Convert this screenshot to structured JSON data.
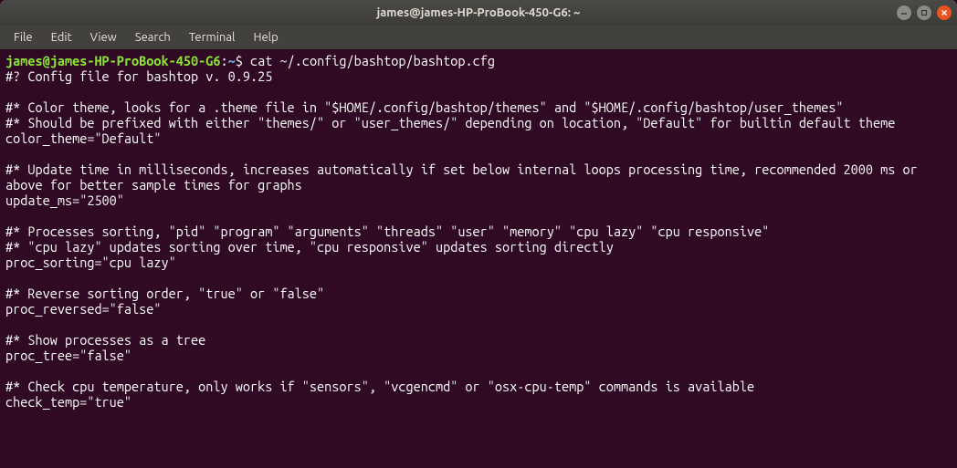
{
  "titlebar": {
    "title": "james@james-HP-ProBook-450-G6: ~"
  },
  "menubar": {
    "file": "File",
    "edit": "Edit",
    "view": "View",
    "search": "Search",
    "terminal": "Terminal",
    "help": "Help"
  },
  "prompt": {
    "userhost": "james@james-HP-ProBook-450-G6",
    "colon": ":",
    "path": "~",
    "dollar": "$ "
  },
  "command": "cat ~/.config/bashtop/bashtop.cfg",
  "output": "#? Config file for bashtop v. 0.9.25\n\n#* Color theme, looks for a .theme file in \"$HOME/.config/bashtop/themes\" and \"$HOME/.config/bashtop/user_themes\"\n#* Should be prefixed with either \"themes/\" or \"user_themes/\" depending on location, \"Default\" for builtin default theme\ncolor_theme=\"Default\"\n\n#* Update time in milliseconds, increases automatically if set below internal loops processing time, recommended 2000 ms or above for better sample times for graphs\nupdate_ms=\"2500\"\n\n#* Processes sorting, \"pid\" \"program\" \"arguments\" \"threads\" \"user\" \"memory\" \"cpu lazy\" \"cpu responsive\"\n#* \"cpu lazy\" updates sorting over time, \"cpu responsive\" updates sorting directly\nproc_sorting=\"cpu lazy\"\n\n#* Reverse sorting order, \"true\" or \"false\"\nproc_reversed=\"false\"\n\n#* Show processes as a tree\nproc_tree=\"false\"\n\n#* Check cpu temperature, only works if \"sensors\", \"vcgencmd\" or \"osx-cpu-temp\" commands is available\ncheck_temp=\"true\""
}
